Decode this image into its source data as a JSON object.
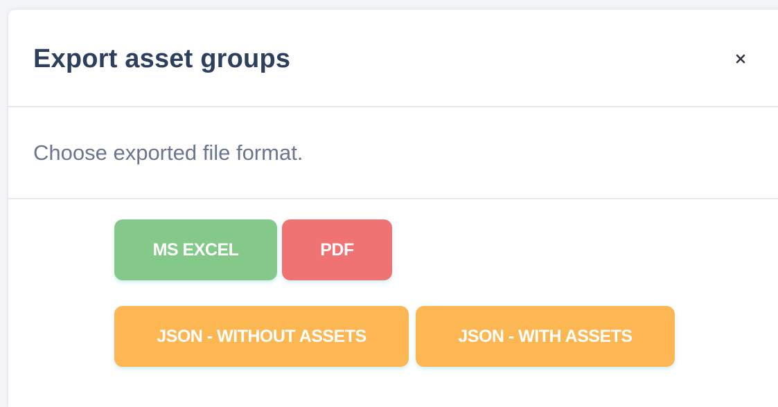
{
  "modal": {
    "title": "Export asset groups",
    "close_label": "×",
    "description": "Choose exported file format."
  },
  "buttons": [
    {
      "label": "MS EXCEL",
      "color": "#84c98a"
    },
    {
      "label": "PDF",
      "color": "#f07373"
    },
    {
      "label": "JSON - WITHOUT ASSETS",
      "color": "#fdb752"
    },
    {
      "label": "JSON - WITH ASSETS",
      "color": "#fdb752"
    }
  ],
  "icons": {
    "close": "close-icon"
  }
}
